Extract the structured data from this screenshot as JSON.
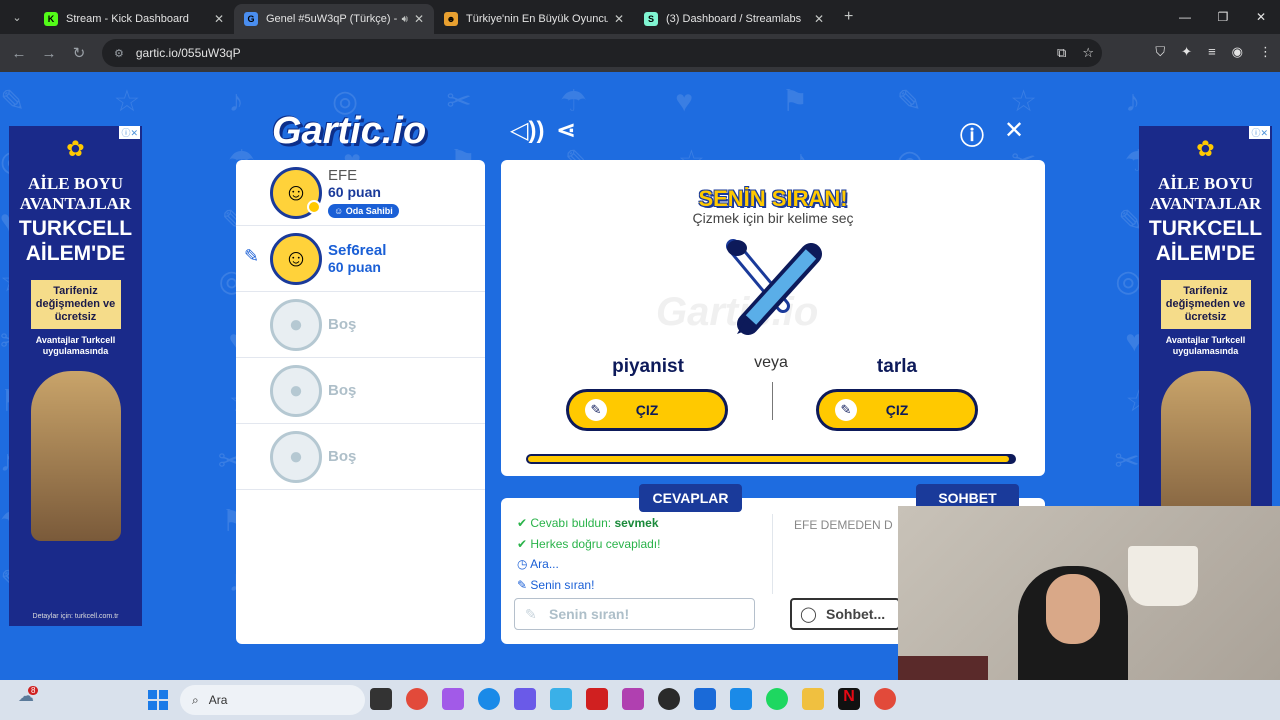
{
  "browser": {
    "tabs": [
      {
        "title": "Stream - Kick Dashboard",
        "fav_color": "#53fc18",
        "fav_letter": "K"
      },
      {
        "title": "Genel #5uW3qP (Türkçe) - ",
        "fav_color": "#4a8ef0",
        "fav_letter": "G"
      },
      {
        "title": "Türkiye'nin En Büyük Oyuncu D",
        "fav_color": "#e8a030",
        "fav_letter": "☻"
      },
      {
        "title": "(3) Dashboard / Streamlabs",
        "fav_color": "#80f5d2",
        "fav_letter": "S"
      }
    ],
    "url": "gartic.io/055uW3qP"
  },
  "ad": {
    "line1": "AİLE BOYU AVANTAJLAR",
    "line2": "TURKCELL AİLEM'DE",
    "box": "Tarifeniz değişmeden ve ücretsiz",
    "box2": "Avantajlar Turkcell uygulamasında",
    "footer": "Detaylar için: turkcell.com.tr"
  },
  "game": {
    "logo": "Gartic.io",
    "players": [
      {
        "name": "EFE",
        "points": "60 puan",
        "badge": "Oda Sahibi"
      },
      {
        "name": "Sef6real",
        "points": "60 puan"
      },
      {
        "name": "Boş"
      },
      {
        "name": "Boş"
      },
      {
        "name": "Boş"
      }
    ],
    "turn_title": "SENİN SIRAN!",
    "turn_subtitle": "Çizmek için bir kelime seç",
    "word_left": "piyanist",
    "or_label": "veya",
    "word_right": "tarla",
    "draw_label": "ÇIZ",
    "timer_fraction": 0.99
  },
  "chat": {
    "answers_tab": "CEVAPLAR",
    "chat_tab": "SOHBET",
    "messages": [
      {
        "prefix": "Cevabı buldun: ",
        "word": "sevmek"
      },
      {
        "text": "Herkes doğru cevapladı!"
      },
      {
        "text": "Ara..."
      },
      {
        "text": "Senin sıran!"
      }
    ],
    "answer_placeholder": "Senin sıran!",
    "chat_placeholder": "Sohbet...",
    "chat_line": "EFE DEMEDEN D"
  },
  "taskbar": {
    "search": "Ara",
    "notif_count": "8"
  }
}
